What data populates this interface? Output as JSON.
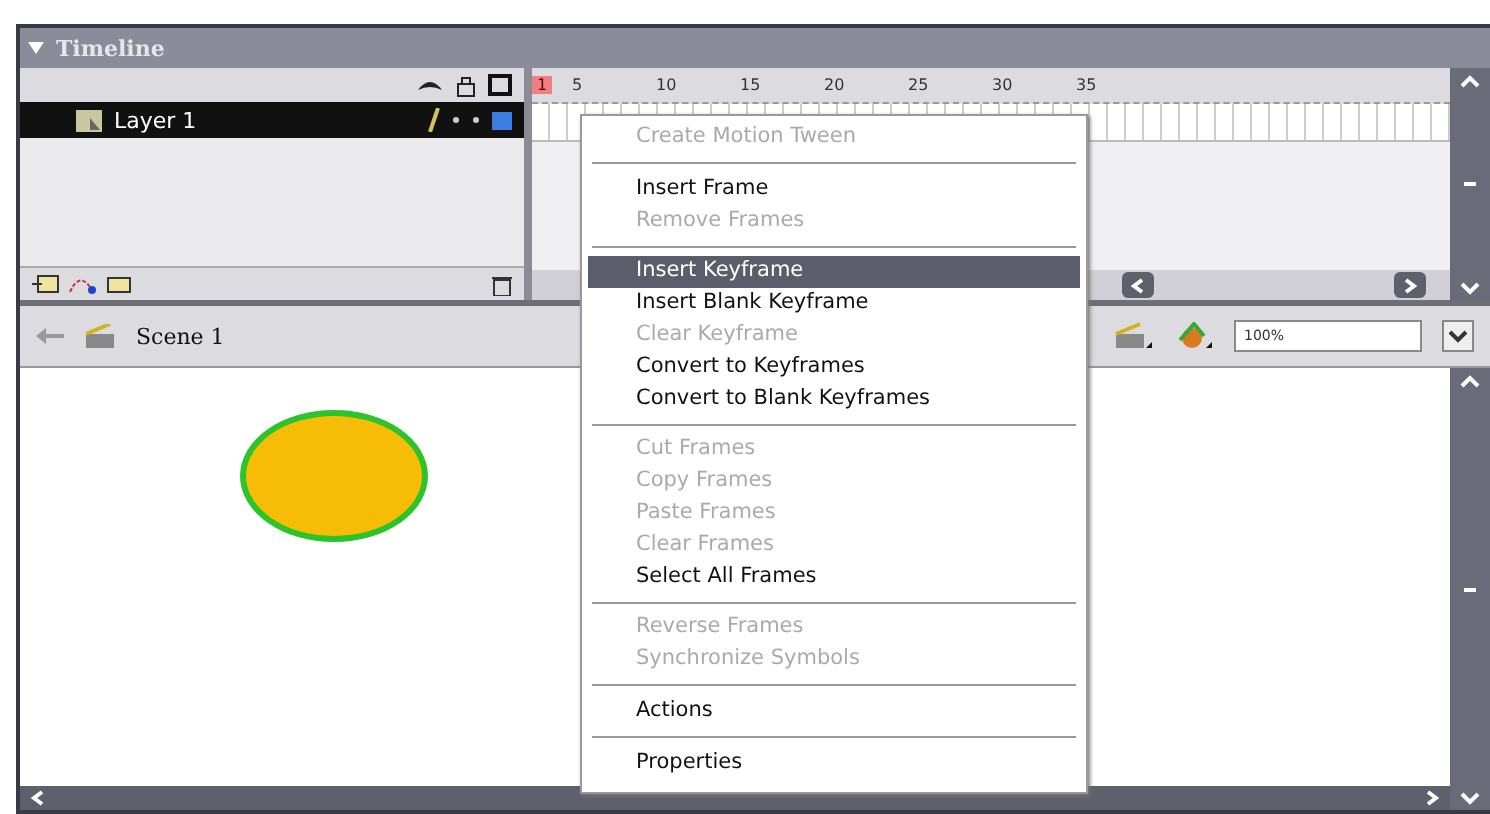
{
  "panel": {
    "title": "Timeline"
  },
  "layers": [
    {
      "name": "Layer 1",
      "selected": true
    }
  ],
  "ruler": [
    "1",
    "5",
    "10",
    "15",
    "20",
    "25",
    "30",
    "35"
  ],
  "scene": {
    "name": "Scene 1"
  },
  "zoom": {
    "value": "100%"
  },
  "context_menu": {
    "items": [
      {
        "kind": "item",
        "label": "Create Motion Tween",
        "disabled": true,
        "selected": false
      },
      {
        "kind": "separator"
      },
      {
        "kind": "item",
        "label": "Insert Frame",
        "disabled": false,
        "selected": false
      },
      {
        "kind": "item",
        "label": "Remove Frames",
        "disabled": true,
        "selected": false
      },
      {
        "kind": "separator"
      },
      {
        "kind": "item",
        "label": "Insert Keyframe",
        "disabled": false,
        "selected": true
      },
      {
        "kind": "item",
        "label": "Insert Blank Keyframe",
        "disabled": false,
        "selected": false
      },
      {
        "kind": "item",
        "label": "Clear Keyframe",
        "disabled": true,
        "selected": false
      },
      {
        "kind": "item",
        "label": "Convert to Keyframes",
        "disabled": false,
        "selected": false
      },
      {
        "kind": "item",
        "label": "Convert to Blank Keyframes",
        "disabled": false,
        "selected": false
      },
      {
        "kind": "separator"
      },
      {
        "kind": "item",
        "label": "Cut Frames",
        "disabled": true,
        "selected": false
      },
      {
        "kind": "item",
        "label": "Copy Frames",
        "disabled": true,
        "selected": false
      },
      {
        "kind": "item",
        "label": "Paste Frames",
        "disabled": true,
        "selected": false
      },
      {
        "kind": "item",
        "label": "Clear Frames",
        "disabled": true,
        "selected": false
      },
      {
        "kind": "item",
        "label": "Select All Frames",
        "disabled": false,
        "selected": false
      },
      {
        "kind": "separator"
      },
      {
        "kind": "item",
        "label": "Reverse Frames",
        "disabled": true,
        "selected": false
      },
      {
        "kind": "item",
        "label": "Synchronize Symbols",
        "disabled": true,
        "selected": false
      },
      {
        "kind": "separator"
      },
      {
        "kind": "item",
        "label": "Actions",
        "disabled": false,
        "selected": false
      },
      {
        "kind": "separator"
      },
      {
        "kind": "item",
        "label": "Properties",
        "disabled": false,
        "selected": false
      }
    ]
  }
}
